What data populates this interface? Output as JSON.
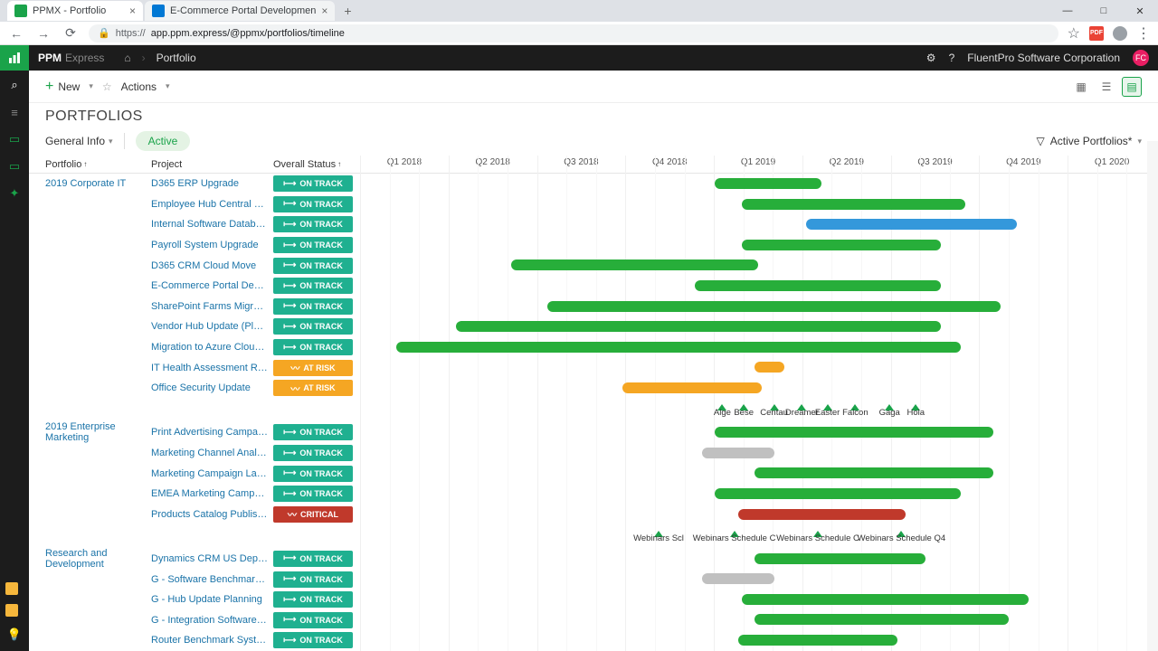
{
  "browser": {
    "tab1": "PPMX - Portfolio",
    "tab2": "E-Commerce Portal Developmen",
    "url_prefix": "https://",
    "url": "app.ppm.express/@ppmx/portfolios/timeline"
  },
  "topbar": {
    "brand_main": "PPM",
    "brand_sub": "Express",
    "breadcrumb": "Portfolio",
    "company": "FluentPro Software Corporation",
    "avatar": "FC"
  },
  "toolbar": {
    "new": "New",
    "actions": "Actions"
  },
  "page": {
    "title": "PORTFOLIOS",
    "general_info": "General Info",
    "active_pill": "Active",
    "filter": "Active Portfolios*"
  },
  "headers": {
    "portfolio": "Portfolio",
    "project": "Project",
    "status": "Overall Status"
  },
  "status_labels": {
    "ontrack": "ON TRACK",
    "atrisk": "AT RISK",
    "critical": "CRITICAL"
  },
  "quarters": [
    "Q1 2018",
    "Q2 2018",
    "Q3 2018",
    "Q4 2018",
    "Q1 2019",
    "Q2 2019",
    "Q3 2019",
    "Q4 2019",
    "Q1 2020"
  ],
  "portfolios": [
    {
      "name": "2019 Corporate IT",
      "projects": [
        {
          "name": "D365 ERP Upgrade",
          "status": "ontrack",
          "bstart": 44.5,
          "blen": 13.5,
          "color": "green"
        },
        {
          "name": "Employee Hub Central Upgr...",
          "status": "ontrack",
          "bstart": 48,
          "blen": 28,
          "color": "green"
        },
        {
          "name": "Internal Software Database ...",
          "status": "ontrack",
          "bstart": 56,
          "blen": 26.5,
          "color": "blue"
        },
        {
          "name": "Payroll System Upgrade",
          "status": "ontrack",
          "bstart": 48,
          "blen": 25,
          "color": "green"
        },
        {
          "name": "D365 CRM Cloud Move",
          "status": "ontrack",
          "bstart": 19,
          "blen": 31,
          "color": "green"
        },
        {
          "name": "E-Commerce Portal Develop...",
          "status": "ontrack",
          "bstart": 42,
          "blen": 31,
          "color": "green"
        },
        {
          "name": "SharePoint Farms Migration ...",
          "status": "ontrack",
          "bstart": 23.5,
          "blen": 57,
          "color": "green"
        },
        {
          "name": "Vendor Hub Update (Planni...",
          "status": "ontrack",
          "bstart": 12,
          "blen": 61,
          "color": "green"
        },
        {
          "name": "Migration to Azure Cloud In...",
          "status": "ontrack",
          "bstart": 4.5,
          "blen": 71,
          "color": "green"
        },
        {
          "name": "IT Health Assessment Repor...",
          "status": "atrisk",
          "bstart": 49.5,
          "blen": 3.8,
          "color": "orange"
        },
        {
          "name": "Office Security Update",
          "status": "atrisk",
          "bstart": 33,
          "blen": 17.5,
          "color": "orange"
        }
      ],
      "milestones": [
        {
          "label": "Alge",
          "pos": 45.5
        },
        {
          "label": "Bese",
          "pos": 48.2
        },
        {
          "label": "Centau",
          "pos": 52
        },
        {
          "label": "Dreamer",
          "pos": 55.5
        },
        {
          "label": "Easter",
          "pos": 58.7
        },
        {
          "label": "Falcon",
          "pos": 62.2
        },
        {
          "label": "Gaga",
          "pos": 66.5
        },
        {
          "label": "Hola",
          "pos": 69.8
        }
      ]
    },
    {
      "name": "2019 Enterprise Marketing",
      "projects": [
        {
          "name": "Print Advertising Campaign ...",
          "status": "ontrack",
          "bstart": 44.5,
          "blen": 35,
          "color": "green"
        },
        {
          "name": "Marketing Channel Analysis",
          "status": "ontrack",
          "bstart": 43,
          "blen": 9,
          "color": "grey"
        },
        {
          "name": "Marketing Campaign Launch",
          "status": "ontrack",
          "bstart": 49.5,
          "blen": 30,
          "color": "green"
        },
        {
          "name": "EMEA Marketing Campaign ...",
          "status": "ontrack",
          "bstart": 44.5,
          "blen": 31,
          "color": "green"
        },
        {
          "name": "Products Catalog Publishing",
          "status": "critical",
          "bstart": 47.5,
          "blen": 21,
          "color": "red"
        }
      ],
      "milestones": [
        {
          "label": "Webinars Scl",
          "pos": 37.5
        },
        {
          "label": "Webinars Schedule C",
          "pos": 47
        },
        {
          "label": "Webinars Schedule C",
          "pos": 57.5
        },
        {
          "label": "Webinars Schedule Q4",
          "pos": 68
        }
      ]
    },
    {
      "name": "Research and Development",
      "projects": [
        {
          "name": "Dynamics CRM US Deploym...",
          "status": "ontrack",
          "bstart": 49.5,
          "blen": 21.5,
          "color": "green"
        },
        {
          "name": "G - Software Benchmarking ...",
          "status": "ontrack",
          "bstart": 43,
          "blen": 9,
          "color": "grey"
        },
        {
          "name": "G - Hub Update Planning",
          "status": "ontrack",
          "bstart": 48,
          "blen": 36,
          "color": "green"
        },
        {
          "name": "G - Integration Software De...",
          "status": "ontrack",
          "bstart": 49.5,
          "blen": 32,
          "color": "green"
        },
        {
          "name": "Router Benchmark System U...",
          "status": "ontrack",
          "bstart": 47.5,
          "blen": 20,
          "color": "green"
        }
      ],
      "milestones": []
    }
  ]
}
